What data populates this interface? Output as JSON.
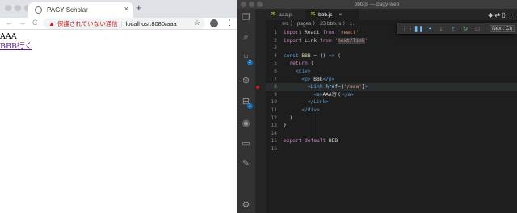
{
  "browser": {
    "tab_title": "PAGY Scholar",
    "tab_close": "×",
    "new_tab": "+",
    "nav": {
      "back": "←",
      "forward": "→",
      "reload": "C"
    },
    "warning_icon": "▲",
    "insecure_text": "保護されていない通信",
    "url": "localhost:8080/aaa",
    "bookmark": "☆",
    "menu": "⋮",
    "page": {
      "heading": "AAA",
      "link_text": "BBB行く"
    }
  },
  "vscode": {
    "window_title": "bbb.js — pagy-web",
    "tabs": [
      {
        "label": "aaa.js"
      },
      {
        "label": "bbb.js"
      }
    ],
    "tab_icon": "JS",
    "tab_close": "×",
    "breadcrumb": "src 〉 pages 〉 JS bbb.js 〉 …",
    "debug_config": "Next: Ch",
    "debug_buttons": [
      "⋮⋮",
      "❚❚",
      "↷",
      "↓",
      "↑",
      "↻",
      "□"
    ],
    "activity": [
      "❐",
      "⌕",
      "⑂",
      "⊛",
      "⊞",
      "◉",
      "▭",
      "✎",
      "⚙"
    ],
    "badges": {
      "scm": "2",
      "extensions": "1"
    },
    "editor_actions": "◆  ⇄  ▯  ⋯",
    "code": [
      {
        "n": "1",
        "t": "import React from 'react'"
      },
      {
        "n": "2",
        "t": "import Link from 'next/link'"
      },
      {
        "n": "3",
        "t": ""
      },
      {
        "n": "4",
        "t": "const BBB = () => ("
      },
      {
        "n": "5",
        "t": "  return ("
      },
      {
        "n": "6",
        "t": "    <div>"
      },
      {
        "n": "7",
        "t": "      <p> BBB</p>"
      },
      {
        "n": "8",
        "t": "        <Link href={'/aaa'}>"
      },
      {
        "n": "9",
        "t": "          <a>AAA行く</a>"
      },
      {
        "n": "10",
        "t": "        </Link>"
      },
      {
        "n": "11",
        "t": "      </div>"
      },
      {
        "n": "12",
        "t": "  )"
      },
      {
        "n": "13",
        "t": "}"
      },
      {
        "n": "14",
        "t": ""
      },
      {
        "n": "15",
        "t": "export default BBB"
      },
      {
        "n": "16",
        "t": ""
      }
    ]
  }
}
